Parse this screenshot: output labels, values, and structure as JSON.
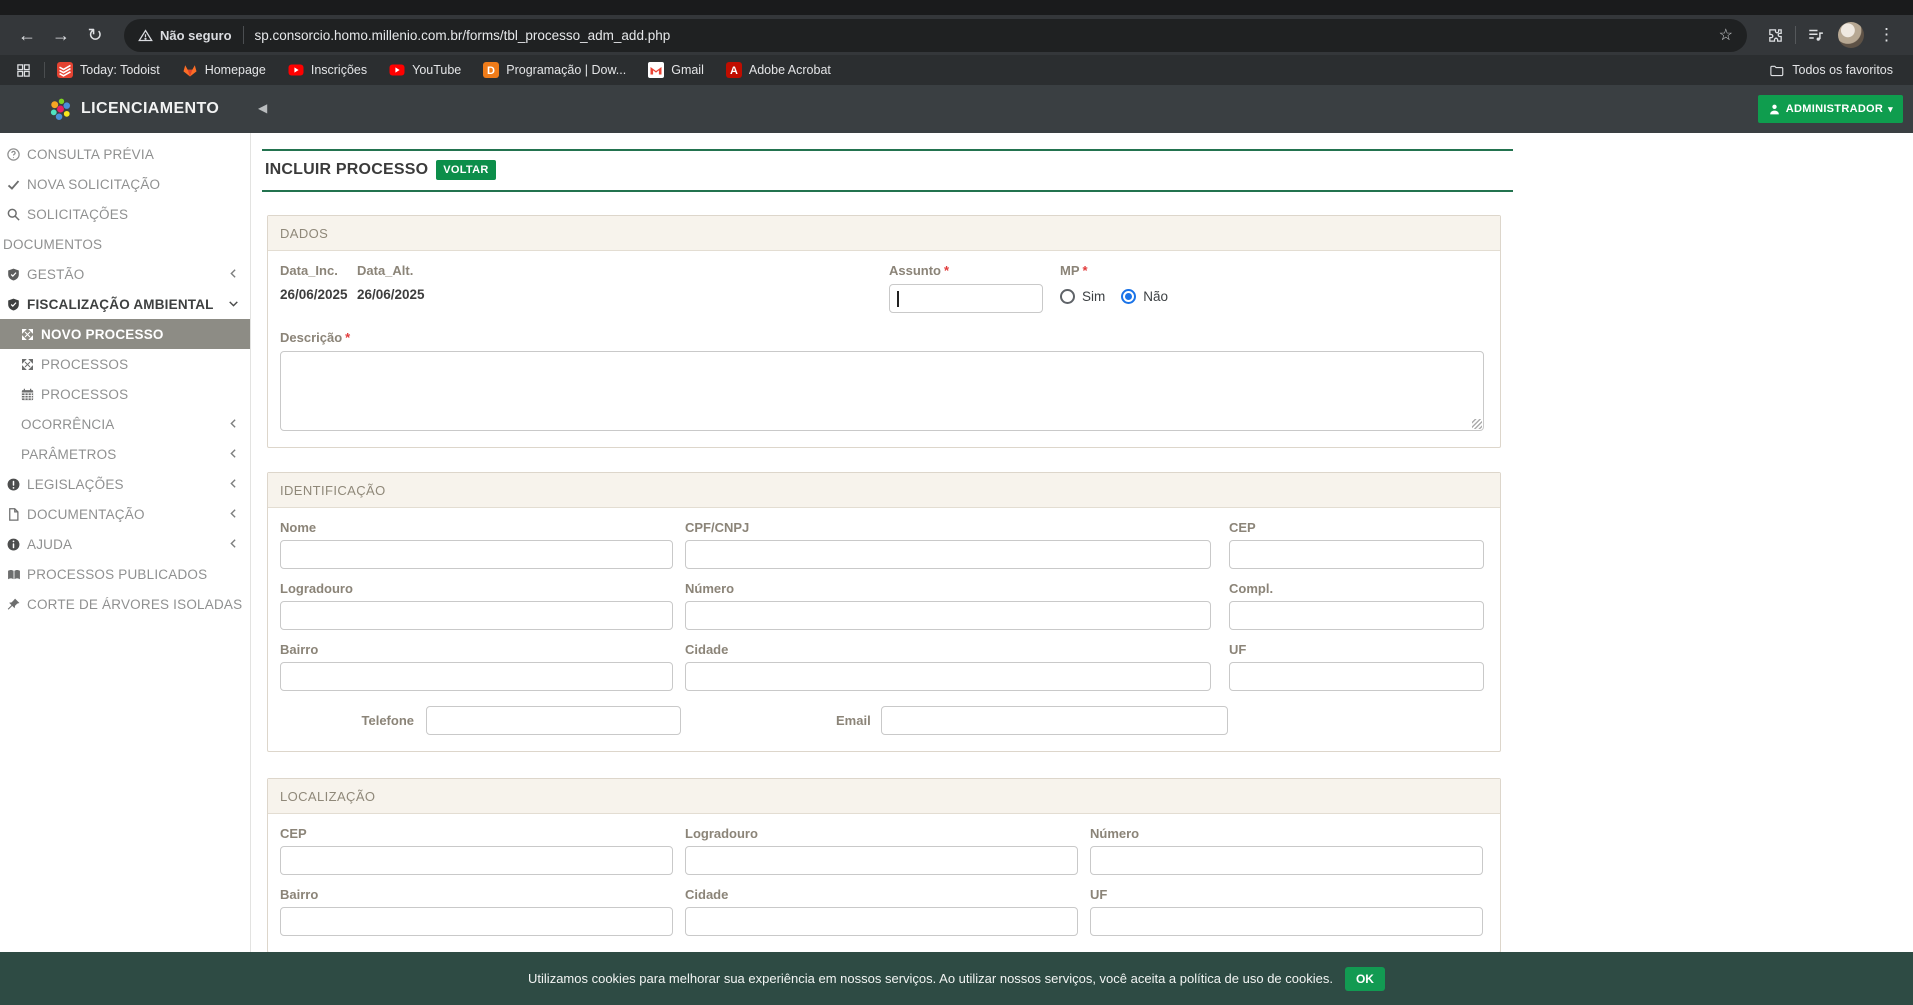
{
  "colors": {
    "accent_green": "#0f9d4e",
    "rule_green": "#23734f",
    "cookie_bg": "#2e4b44",
    "selected_item_bg": "#8d8c85"
  },
  "browser": {
    "security_chip": "Não seguro",
    "url": "sp.consorcio.homo.millenio.com.br/forms/tbl_processo_adm_add.php",
    "bookmarks": [
      {
        "label": "Today: Todoist",
        "icon": "todoist-icon"
      },
      {
        "label": "Homepage",
        "icon": "gitlab-icon"
      },
      {
        "label": "Inscrições",
        "icon": "youtube-icon"
      },
      {
        "label": "YouTube",
        "icon": "youtube-icon"
      },
      {
        "label": "Programação | Dow...",
        "icon": "devdocs-icon"
      },
      {
        "label": "Gmail",
        "icon": "gmail-icon"
      },
      {
        "label": "Adobe Acrobat",
        "icon": "acrobat-icon"
      }
    ],
    "all_bookmarks_label": "Todos os favoritos"
  },
  "header": {
    "app_title": "LICENCIAMENTO",
    "user_menu_label": "ADMINISTRADOR"
  },
  "sidebar": {
    "items": [
      {
        "label": "CONSULTA PRÉVIA",
        "icon": "question-circle"
      },
      {
        "label": "NOVA SOLICITAÇÃO",
        "icon": "check"
      },
      {
        "label": "SOLICITAÇÕES",
        "icon": "search"
      },
      {
        "label": "DOCUMENTOS",
        "icon": null
      },
      {
        "label": "GESTÃO",
        "icon": "shield-check",
        "chevron": "left"
      },
      {
        "label": "FISCALIZAÇÃO AMBIENTAL",
        "icon": "shield-check",
        "chevron": "down",
        "active": true
      },
      {
        "label": "NOVO PROCESSO",
        "icon": "arrows-out",
        "selected": true
      },
      {
        "label": "PROCESSOS",
        "icon": "arrows-out"
      },
      {
        "label": "PROCESSOS",
        "icon": "calendar"
      },
      {
        "label": "OCORRÊNCIA",
        "icon": null,
        "chevron": "left"
      },
      {
        "label": "PARÂMETROS",
        "icon": null,
        "chevron": "left"
      },
      {
        "label": "LEGISLAÇÕES",
        "icon": "exclamation-circle",
        "chevron": "left"
      },
      {
        "label": "DOCUMENTAÇÃO",
        "icon": "file",
        "chevron": "left"
      },
      {
        "label": "AJUDA",
        "icon": "info-circle",
        "chevron": "left"
      },
      {
        "label": "PROCESSOS PUBLICADOS",
        "icon": "book-open"
      },
      {
        "label": "CORTE DE ÁRVORES ISOLADAS",
        "icon": "pushpin"
      }
    ]
  },
  "main": {
    "page_title": "INCLUIR PROCESSO",
    "back_button": "VOLTAR",
    "required_mark": "*",
    "dados": {
      "title": "DADOS",
      "data_inc_label": "Data_Inc.",
      "data_alt_label": "Data_Alt.",
      "data_inc_value": "26/06/2025",
      "data_alt_value": "26/06/2025",
      "assunto_label": "Assunto",
      "assunto_value": "",
      "mp_label": "MP",
      "mp_options": [
        {
          "label": "Sim",
          "checked": false
        },
        {
          "label": "Não",
          "checked": true
        }
      ],
      "descricao_label": "Descrição",
      "descricao_value": ""
    },
    "identificacao": {
      "title": "IDENTIFICAÇÃO",
      "nome_label": "Nome",
      "cpf_label": "CPF/CNPJ",
      "cep_label": "CEP",
      "logradouro_label": "Logradouro",
      "numero_label": "Número",
      "compl_label": "Compl.",
      "bairro_label": "Bairro",
      "cidade_label": "Cidade",
      "uf_label": "UF",
      "telefone_label": "Telefone",
      "email_label": "Email"
    },
    "localizacao": {
      "title": "LOCALIZAÇÃO",
      "cep_label": "CEP",
      "logradouro_label": "Logradouro",
      "numero_label": "Número",
      "bairro_label": "Bairro",
      "cidade_label": "Cidade",
      "uf_label": "UF"
    }
  },
  "cookie_bar": {
    "message": "Utilizamos cookies para melhorar sua experiência em nossos serviços. Ao utilizar nossos serviços, você aceita a política de uso de cookies.",
    "ok_label": "OK"
  }
}
